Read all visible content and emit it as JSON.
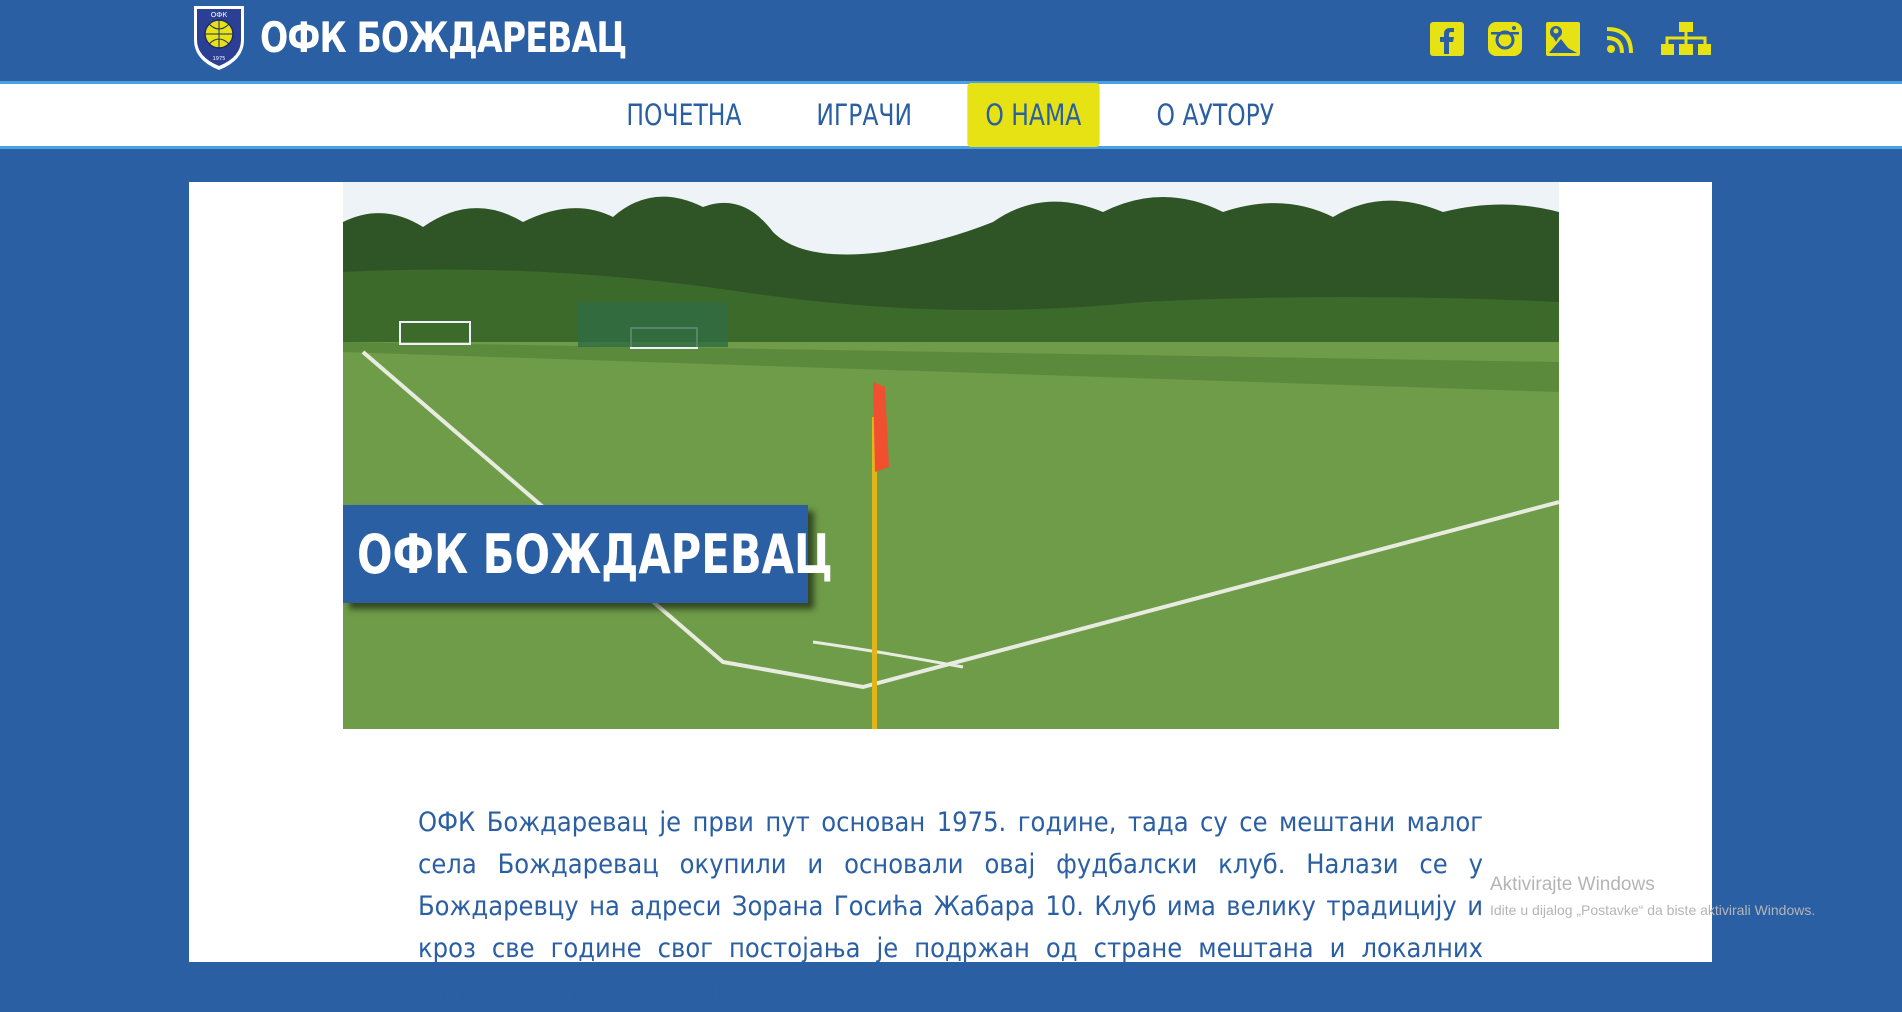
{
  "header": {
    "title": "ОФК БОЖДАРЕВАЦ",
    "logo": {
      "top_text": "ОФК",
      "side_text": "БОЖДАРЕВАЦ",
      "year": "1975"
    },
    "social_icons": [
      "facebook-icon",
      "instagram-icon",
      "map-icon",
      "rss-icon",
      "sitemap-icon"
    ],
    "accent_color": "#e6e214",
    "brand_color": "#2b5fa3"
  },
  "nav": {
    "items": [
      {
        "label": "ПОЧЕТНА",
        "active": false
      },
      {
        "label": "ИГРАЧИ",
        "active": false
      },
      {
        "label": "О НАМА",
        "active": true
      },
      {
        "label": "О АУТОРУ",
        "active": false
      }
    ]
  },
  "hero": {
    "title": "ОФК БОЖДАРЕВАЦ"
  },
  "article": {
    "text": "ОФК Бождаревац је први пут основан 1975. године, тада су се мештани малог села Бождаревац окупили и основали овај фудбалски клуб. Налази се у Бождаревцу на адреси Зорана Госића Жабара 10. Клуб има велику традицију и кроз све године свог постојања је подржан од стране мештана и локалних симпатера. Највише живе тренирале и каже је"
  },
  "watermark": {
    "title": "Aktivirajte Windows",
    "subtitle": "Idite u dijalog „Postavke“ da biste aktivirali Windows."
  }
}
